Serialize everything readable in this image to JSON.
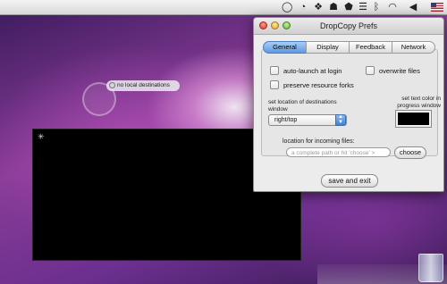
{
  "menubar": {
    "icons": [
      "spotlight-circle-icon",
      "clock-icon",
      "dropbox-icon",
      "user-icon",
      "growl-icon",
      "menu-icon",
      "bluetooth-icon",
      "wifi-icon",
      "volume-icon",
      "us-flag-icon"
    ]
  },
  "desktop": {
    "destinations_label": "no local destinations"
  },
  "prefs_window": {
    "title": "DropCopy Prefs",
    "tabs": [
      "General",
      "Display",
      "Feedback",
      "Network"
    ],
    "active_tab": "General",
    "options": {
      "auto_launch": "auto-launch at login",
      "overwrite": "overwrite files",
      "preserve_forks": "preserve resource forks"
    },
    "location_label": "set location of destinations window",
    "location_value": "right/top",
    "text_color_label": "set text color in progress window",
    "text_color": "#000000",
    "incoming_label": "location for incoming files:",
    "incoming_placeholder": "a complete path or hit 'choose' >",
    "choose_label": "choose",
    "save_label": "save and exit"
  },
  "progress_window": {
    "star": "✳"
  }
}
